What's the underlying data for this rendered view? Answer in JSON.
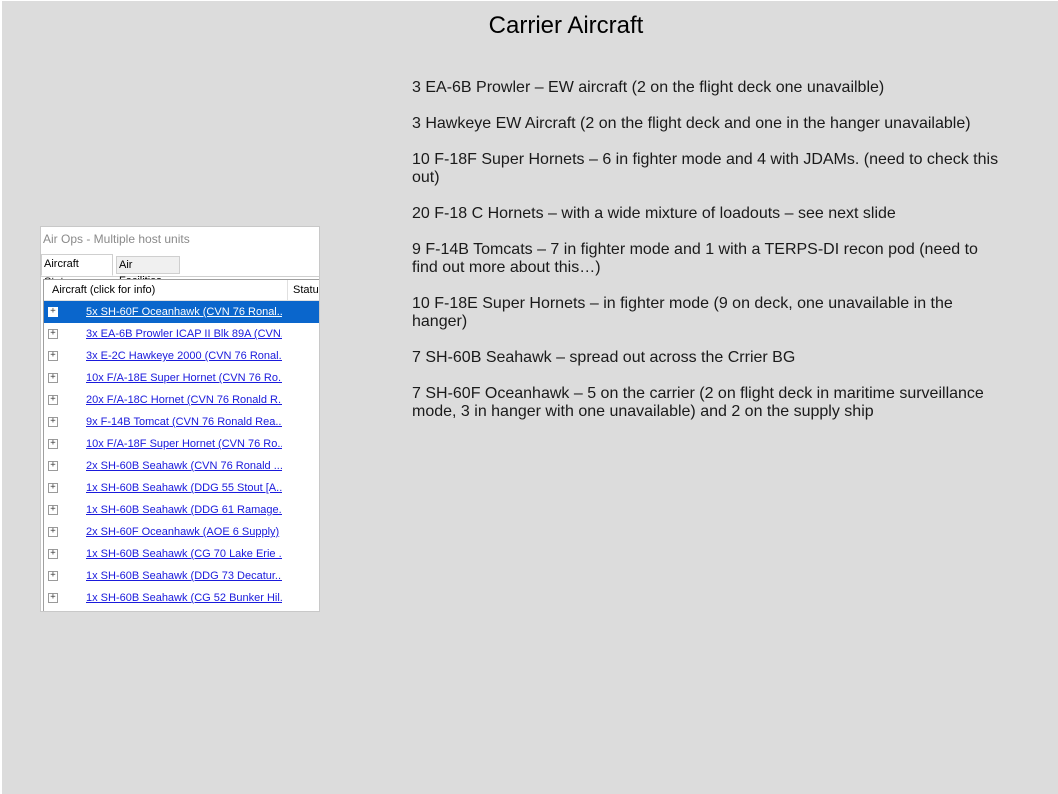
{
  "slide": {
    "title": "Carrier Aircraft",
    "bullets": [
      "3 EA-6B Prowler – EW aircraft (2 on the flight deck one unavailble)",
      "3 Hawkeye EW Aircraft (2 on the flight deck and one in the hanger unavailable)",
      "10 F-18F Super Hornets – 6 in fighter mode and 4 with JDAMs.  (need to check this out)",
      "20 F-18 C Hornets – with a wide mixture of loadouts – see next slide",
      "9 F-14B Tomcats – 7 in fighter mode and 1 with a TERPS-DI recon pod (need to find out more about this…)",
      "10 F-18E Super Hornets – in fighter mode (9 on deck, one unavailable in the hanger)",
      "7 SH-60B Seahawk – spread out across the Crrier BG",
      "7 SH-60F Oceanhawk – 5 on the carrier (2 on flight deck in maritime surveillance mode, 3 in hanger with one unavailable) and 2 on the supply ship"
    ]
  },
  "window": {
    "title": "Air Ops - Multiple host units",
    "tabs": [
      "Aircraft Status",
      "Air Facilities"
    ],
    "columns": [
      "Aircraft (click for info)",
      "Status"
    ],
    "rows": [
      "5x SH-60F Oceanhawk (CVN 76 Ronal...",
      "3x EA-6B Prowler ICAP II Blk 89A (CVN...",
      "3x E-2C Hawkeye 2000 (CVN 76 Ronal...",
      "10x F/A-18E Super Hornet (CVN 76 Ro...",
      "20x F/A-18C Hornet (CVN 76 Ronald R...",
      "9x F-14B Tomcat (CVN 76 Ronald Rea...",
      "10x F/A-18F Super Hornet (CVN 76 Ro...",
      "2x SH-60B Seahawk (CVN 76 Ronald ...",
      "1x SH-60B Seahawk (DDG 55 Stout [A...",
      "1x SH-60B Seahawk (DDG 61 Ramage...",
      "2x SH-60F Oceanhawk (AOE 6 Supply)",
      "1x SH-60B Seahawk (CG 70 Lake Erie ...",
      "1x SH-60B Seahawk (DDG 73 Decatur...",
      "1x SH-60B Seahawk (CG 52 Bunker Hil..."
    ],
    "expander_glyph": "+"
  },
  "colors": {
    "selection": "#0a66cc",
    "link": "#1a1adc",
    "slide_bg": "#dcdcdc"
  }
}
